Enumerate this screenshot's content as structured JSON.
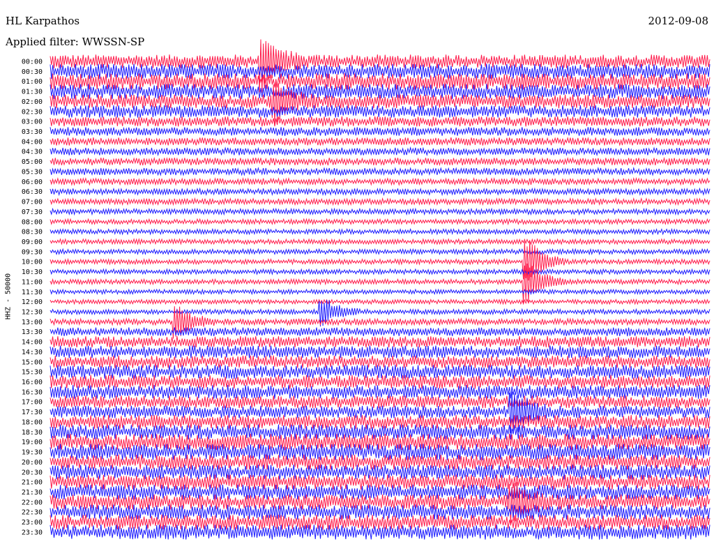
{
  "header": {
    "station": "HL Karpathos",
    "date": "2012-09-08",
    "filter": "Applied filter: WWSSN-SP"
  },
  "chart_data": {
    "type": "line",
    "chart_kind": "helicorder",
    "ylabel": "HHZ - 50000",
    "row_labels": [
      "00:00",
      "00:30",
      "01:00",
      "01:30",
      "02:00",
      "02:30",
      "03:00",
      "03:30",
      "04:00",
      "04:30",
      "05:00",
      "05:30",
      "06:00",
      "06:30",
      "07:00",
      "07:30",
      "08:00",
      "08:30",
      "09:00",
      "09:30",
      "10:00",
      "10:30",
      "11:00",
      "11:30",
      "12:00",
      "12:30",
      "13:00",
      "13:30",
      "14:00",
      "14:30",
      "15:00",
      "15:30",
      "16:00",
      "16:30",
      "17:00",
      "17:30",
      "18:00",
      "18:30",
      "19:00",
      "19:30",
      "20:00",
      "20:30",
      "21:00",
      "21:30",
      "22:00",
      "22:30",
      "23:00",
      "23:30"
    ],
    "trace_colors": [
      "#ff1a4a",
      "#1a1aff"
    ],
    "noise_level": [
      0.55,
      0.6,
      0.65,
      0.6,
      0.55,
      0.5,
      0.4,
      0.35,
      0.32,
      0.3,
      0.3,
      0.28,
      0.26,
      0.25,
      0.24,
      0.22,
      0.2,
      0.2,
      0.2,
      0.2,
      0.2,
      0.2,
      0.2,
      0.18,
      0.18,
      0.2,
      0.25,
      0.35,
      0.45,
      0.5,
      0.5,
      0.55,
      0.55,
      0.55,
      0.5,
      0.5,
      0.55,
      0.6,
      0.65,
      0.65,
      0.6,
      0.6,
      0.6,
      0.6,
      0.6,
      0.6,
      0.6,
      0.6
    ],
    "events": [
      {
        "row": 0,
        "pos": 0.32,
        "amp": 2.5
      },
      {
        "row": 4,
        "pos": 0.34,
        "amp": 1.6
      },
      {
        "row": 20,
        "pos": 0.72,
        "amp": 2.4
      },
      {
        "row": 22,
        "pos": 0.72,
        "amp": 2.2
      },
      {
        "row": 25,
        "pos": 0.41,
        "amp": 1.4
      },
      {
        "row": 26,
        "pos": 0.19,
        "amp": 1.5
      },
      {
        "row": 35,
        "pos": 0.7,
        "amp": 2.0
      },
      {
        "row": 44,
        "pos": 0.7,
        "amp": 1.8
      }
    ]
  }
}
